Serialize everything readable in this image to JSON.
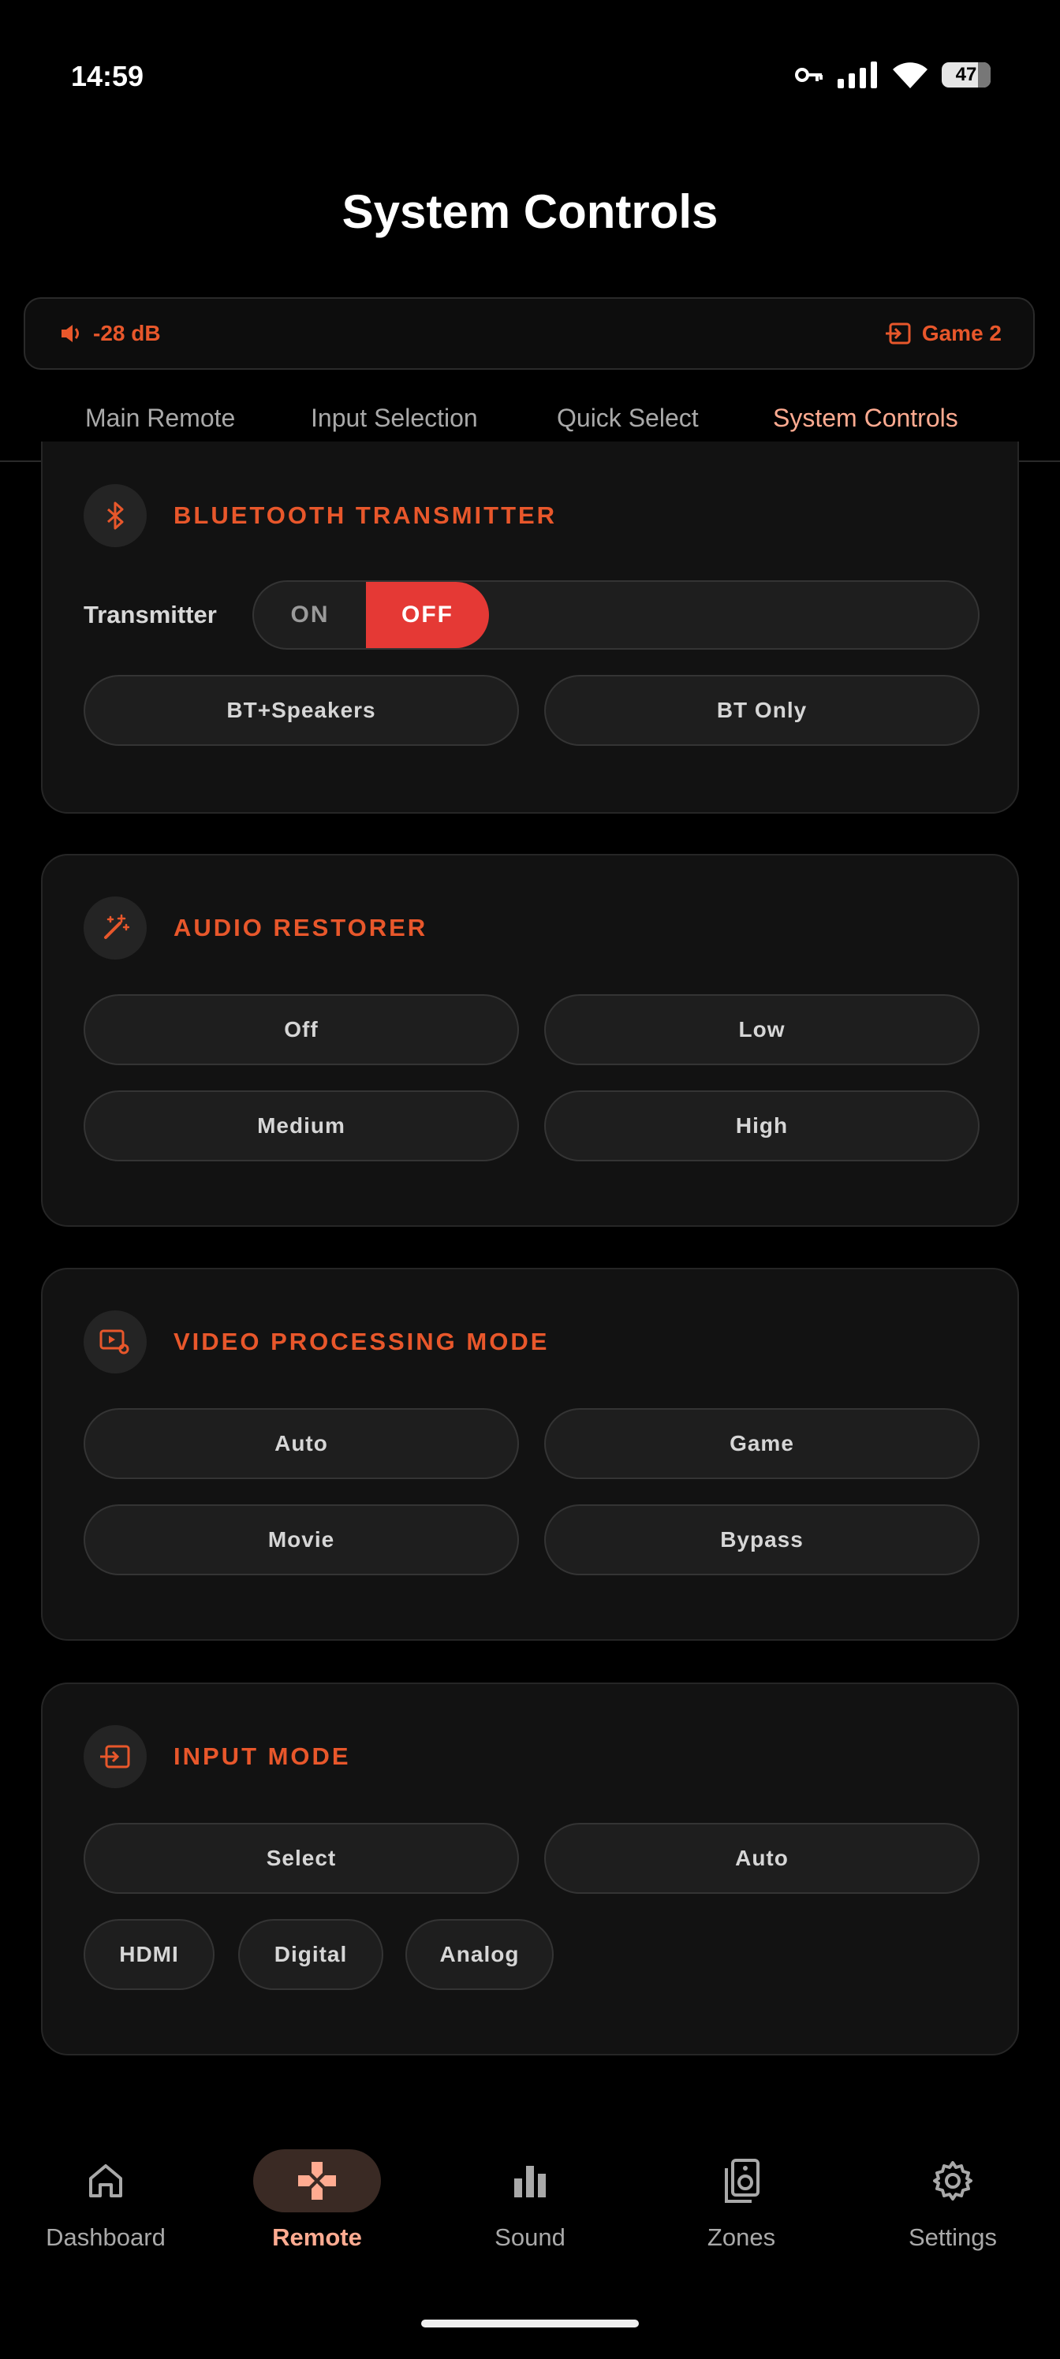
{
  "status_bar": {
    "time": "14:59",
    "battery": "47"
  },
  "header": {
    "title": "System Controls"
  },
  "now_playing": {
    "volume": "-28 dB",
    "source": "Game 2"
  },
  "tabs": [
    {
      "label": "Main Remote"
    },
    {
      "label": "Input Selection"
    },
    {
      "label": "Quick Select"
    },
    {
      "label": "System Controls",
      "active": true
    }
  ],
  "bluetooth": {
    "title": "BLUETOOTH TRANSMITTER",
    "row_label": "Transmitter",
    "toggle": {
      "on": "ON",
      "off": "OFF",
      "selected": "OFF"
    },
    "options": [
      "BT+Speakers",
      "BT Only"
    ]
  },
  "audio_restorer": {
    "title": "AUDIO RESTORER",
    "options": [
      "Off",
      "Low",
      "Medium",
      "High"
    ]
  },
  "video_processing": {
    "title": "VIDEO PROCESSING MODE",
    "options": [
      "Auto",
      "Game",
      "Movie",
      "Bypass"
    ]
  },
  "input_mode": {
    "title": "INPUT MODE",
    "options": [
      "Select",
      "Auto"
    ],
    "types": [
      "HDMI",
      "Digital",
      "Analog"
    ]
  },
  "nav": [
    {
      "label": "Dashboard",
      "icon": "home-icon"
    },
    {
      "label": "Remote",
      "icon": "gamepad-icon",
      "active": true
    },
    {
      "label": "Sound",
      "icon": "bar-chart-icon"
    },
    {
      "label": "Zones",
      "icon": "speaker-icon"
    },
    {
      "label": "Settings",
      "icon": "gear-icon"
    }
  ],
  "colors": {
    "accent": "#e8572b",
    "active_tab": "#ffab91",
    "toggle_off": "#e53935",
    "background": "#000000",
    "card": "#121212"
  }
}
